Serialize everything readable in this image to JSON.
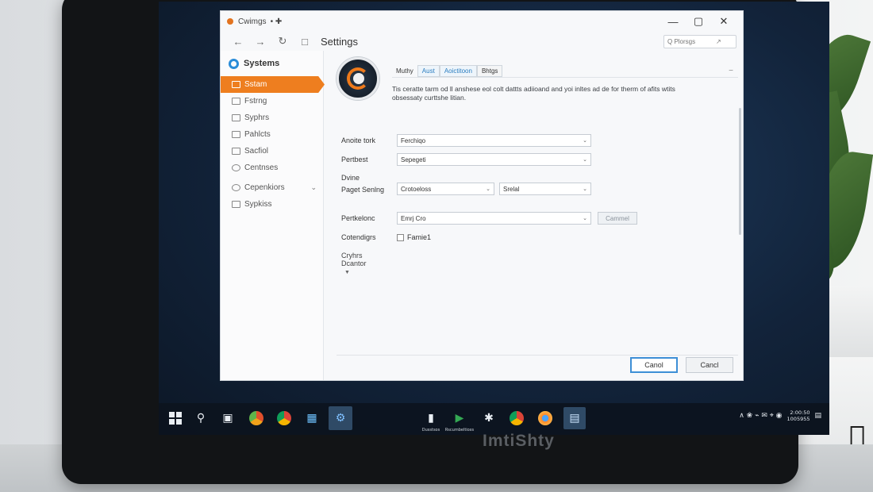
{
  "monitor_brand": "ImtiShty",
  "window": {
    "title": "Cwimgs",
    "pin": "• ✚",
    "controls": {
      "minimize": "—",
      "maximize": "▢",
      "close": "✕"
    }
  },
  "nav": {
    "back": "←",
    "forward": "→",
    "refresh": "↻",
    "page": "□",
    "breadcrumb": "Settings",
    "search_placeholder": "Q Plorsgs"
  },
  "sidebar": {
    "brand": "Systems",
    "items": [
      {
        "label": "Sstam",
        "active": true
      },
      {
        "label": "Fstrng"
      },
      {
        "label": "Syphrs"
      },
      {
        "label": "Pahlcts"
      },
      {
        "label": "Sacfiol"
      },
      {
        "label": "Centnses"
      },
      {
        "label": "Cepenkiors",
        "chevron": "⌄"
      },
      {
        "label": "Sypkiss"
      }
    ]
  },
  "content": {
    "tabs": [
      "Muthy",
      "Aust",
      "Aoictitoon",
      "Bhtgs"
    ],
    "collapse": "−",
    "description": "Tis ceratte tarm od ll anshese eol colt dattts adiioand and yoi inltes ad de for therm of afits wtits obsessaty curttshe litian.",
    "fields": {
      "row1": {
        "label": "Anoite tork",
        "value": "Ferchiqo"
      },
      "row2": {
        "label": "Pertbest",
        "value": "Sepegeti"
      },
      "row3": {
        "label_line1": "Dvine",
        "label_line2": "Paget Senlng",
        "value1": "Crotoeloss",
        "value2": "Srelal"
      },
      "row4": {
        "label": "Pertkelonc",
        "value": "Emrj Cro",
        "button": "Cammel"
      },
      "row5": {
        "label": "Cotendigrs",
        "checkbox_label": "Famie1"
      }
    },
    "advanced": "Cryhrs Dcantor",
    "buttons": {
      "primary": "Canol",
      "secondary": "Cancl"
    }
  },
  "taskbar": {
    "items": [
      {
        "name": "start"
      },
      {
        "name": "search",
        "glyph": "⚲"
      },
      {
        "name": "camera",
        "glyph": "▣"
      },
      {
        "name": "app-orange"
      },
      {
        "name": "chrome"
      },
      {
        "name": "store",
        "glyph": "▦"
      },
      {
        "name": "settings-active",
        "glyph": "⚙"
      },
      {
        "name": "notes",
        "glyph": "▮",
        "label": "Dusstsos"
      },
      {
        "name": "play",
        "glyph": "▶",
        "label": "Rscumbeltioxs"
      },
      {
        "name": "gear",
        "glyph": "✱"
      },
      {
        "name": "chrome-2"
      },
      {
        "name": "browser"
      },
      {
        "name": "files",
        "glyph": "▤"
      }
    ],
    "tray": {
      "icons": "∧ ❀ ⌁ ✉ ⌖ ◉",
      "clock_line1": "2:00:50",
      "clock_line2": "1005955"
    }
  },
  "colors": {
    "accent": "#ee7e1f",
    "primary_blue": "#3d8fd6"
  }
}
